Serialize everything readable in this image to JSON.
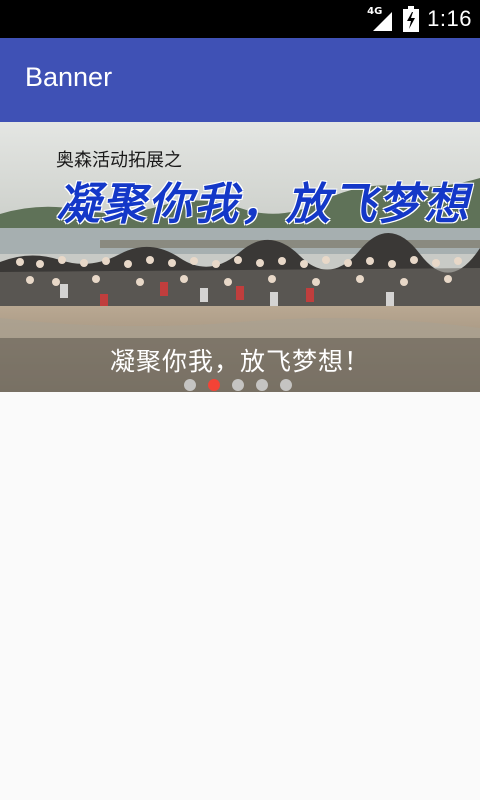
{
  "status_bar": {
    "network_label": "4G",
    "time": "1:16",
    "icons": [
      "signal-icon",
      "battery-charging-icon"
    ]
  },
  "app_bar": {
    "title": "Banner",
    "color": "#3f51b5"
  },
  "banner": {
    "photo_subtitle": "奥森活动拓展之",
    "photo_headline": "凝聚你我，放飞梦想",
    "caption": "凝聚你我，放飞梦想！",
    "page_count": 5,
    "active_page": 2,
    "indicator_active_color": "#f44336"
  }
}
